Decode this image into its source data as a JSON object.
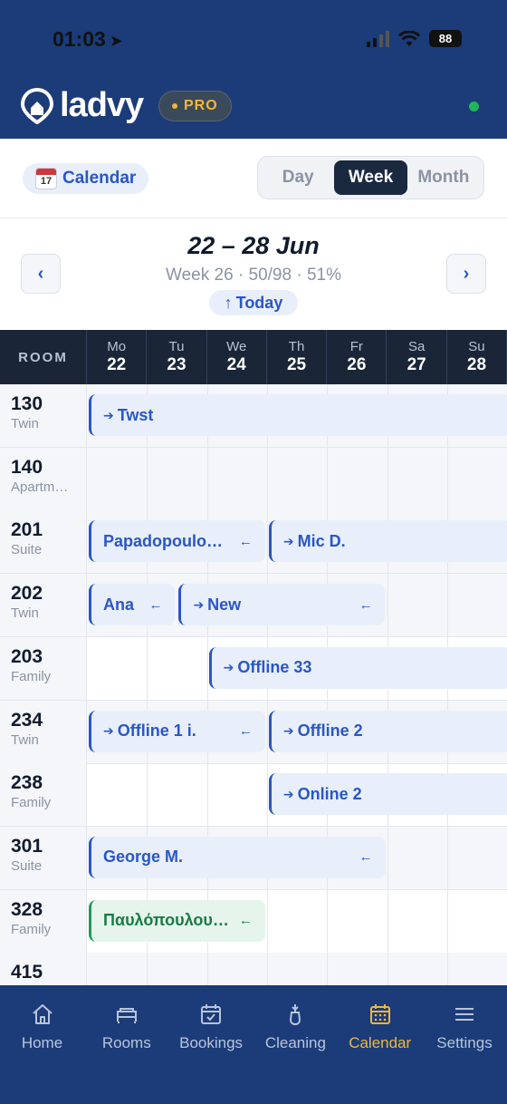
{
  "status_bar": {
    "time": "01:03",
    "battery": "88"
  },
  "header": {
    "logo_text": "ladvy",
    "badge": "PRO"
  },
  "toolbar": {
    "calendar_chip": "Calendar",
    "calendar_icon_day": "17",
    "views": [
      "Day",
      "Week",
      "Month"
    ],
    "active_view": "Week"
  },
  "week_nav": {
    "title": "22 – 28 Jun",
    "subtitle": "Week 26 · 50/98 · 51%",
    "today": "Today",
    "prev": "‹",
    "next": "›"
  },
  "grid": {
    "room_header": "ROOM",
    "days": [
      {
        "name": "Mo",
        "num": "22"
      },
      {
        "name": "Tu",
        "num": "23"
      },
      {
        "name": "We",
        "num": "24"
      },
      {
        "name": "Th",
        "num": "25"
      },
      {
        "name": "Fr",
        "num": "26"
      },
      {
        "name": "Sa",
        "num": "27"
      },
      {
        "name": "Su",
        "num": "28"
      }
    ],
    "rooms": [
      {
        "num": "130",
        "type": "Twin",
        "shaded": true
      },
      {
        "num": "140",
        "type": "Apartm…",
        "shaded": true
      },
      {
        "num": "201",
        "type": "Suite",
        "shaded": true
      },
      {
        "num": "202",
        "type": "Twin",
        "shaded": true
      },
      {
        "num": "203",
        "type": "Family",
        "shaded": false
      },
      {
        "num": "234",
        "type": "Twin",
        "shaded": true
      },
      {
        "num": "238",
        "type": "Family",
        "shaded": false
      },
      {
        "num": "301",
        "type": "Suite",
        "shaded": true
      },
      {
        "num": "328",
        "type": "Family",
        "shaded": false
      },
      {
        "num": "415",
        "type": "",
        "shaded": true
      }
    ],
    "bookings": [
      {
        "row": 0,
        "label": "Twst",
        "arrive": true,
        "depart": false,
        "color": "blue"
      },
      {
        "row": 2,
        "label": "Papadopoulo…",
        "arrive": false,
        "depart": true,
        "color": "blue"
      },
      {
        "row": 2,
        "label": "Mic D.",
        "arrive": true,
        "depart": false,
        "color": "blue"
      },
      {
        "row": 3,
        "label": "Ana",
        "arrive": false,
        "depart": true,
        "color": "blue"
      },
      {
        "row": 3,
        "label": "New",
        "arrive": true,
        "depart": true,
        "color": "blue"
      },
      {
        "row": 4,
        "label": "Offline 33",
        "arrive": true,
        "depart": false,
        "color": "blue"
      },
      {
        "row": 5,
        "label": "Offline 1 i.",
        "arrive": true,
        "depart": true,
        "color": "blue"
      },
      {
        "row": 5,
        "label": "Offline 2",
        "arrive": true,
        "depart": false,
        "color": "blue"
      },
      {
        "row": 6,
        "label": "Online 2",
        "arrive": true,
        "depart": false,
        "color": "blue"
      },
      {
        "row": 7,
        "label": "George M.",
        "arrive": false,
        "depart": true,
        "color": "blue"
      },
      {
        "row": 8,
        "label": "Παυλόπουλου…",
        "arrive": false,
        "depart": true,
        "color": "green"
      }
    ]
  },
  "tabbar": {
    "tabs": [
      {
        "label": "Home",
        "icon": "home-icon"
      },
      {
        "label": "Rooms",
        "icon": "bed-icon"
      },
      {
        "label": "Bookings",
        "icon": "calendar-check-icon"
      },
      {
        "label": "Cleaning",
        "icon": "broom-icon"
      },
      {
        "label": "Calendar",
        "icon": "calendar-grid-icon"
      },
      {
        "label": "Settings",
        "icon": "menu-icon"
      }
    ],
    "active": "Calendar"
  },
  "colors": {
    "header_bg": "#1b3c78",
    "accent_blue": "#2a56c6",
    "accent_gold": "#f0b73a",
    "grid_head_bg": "#1b2538",
    "green": "#1f9a57"
  }
}
